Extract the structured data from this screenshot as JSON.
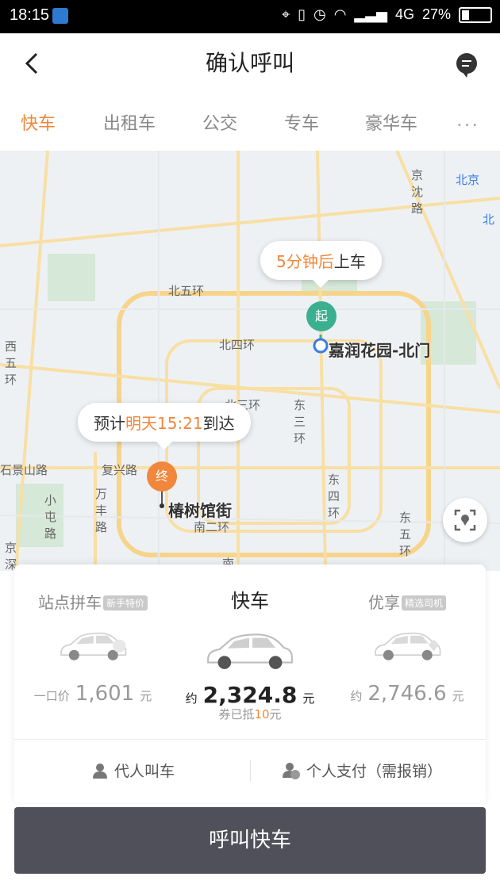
{
  "status": {
    "time": "18:15",
    "network": "4G",
    "battery": "27%",
    "battery_level": 0.27
  },
  "header": {
    "title": "确认呼叫"
  },
  "tabs": [
    {
      "label": "快车",
      "active": true
    },
    {
      "label": "出租车"
    },
    {
      "label": "公交"
    },
    {
      "label": "专车"
    },
    {
      "label": "豪华车"
    }
  ],
  "tabs_more": "···",
  "map": {
    "pickup_bubble": {
      "highlight": "5分钟后",
      "text": "上车"
    },
    "eta_bubble": {
      "prefix": "预计",
      "highlight": "明天15:21",
      "suffix": "到达"
    },
    "start_pin": "起",
    "start_place": "嘉润花园-北门",
    "end_pin": "终",
    "end_place": "椿树馆街",
    "labels": [
      "北五环",
      "北四环",
      "北三环",
      "东三环",
      "东四环",
      "东五环",
      "西五环",
      "复兴路",
      "石景山路",
      "万丰路",
      "小屯路",
      "南二环",
      "京沈路",
      "北京",
      "北",
      "南",
      "京深路"
    ]
  },
  "options": {
    "left": {
      "name": "站点拼车",
      "tag": "新手特价",
      "price_prefix": "一口价",
      "price": "1,601",
      "unit": "元"
    },
    "center": {
      "name": "快车",
      "price_prefix": "约",
      "price": "2,324.8",
      "unit": "元",
      "coupon_prefix": "券已抵",
      "coupon_amount": "10",
      "coupon_unit": "元"
    },
    "right": {
      "name": "优享",
      "tag": "精选司机",
      "price_prefix": "约",
      "price": "2,746.6",
      "unit": "元"
    }
  },
  "actions": {
    "proxy_call": "代人叫车",
    "payment": "个人支付（需报销）",
    "call_button": "呼叫快车"
  },
  "colors": {
    "accent": "#f0873c",
    "start_pin": "#3bb08f",
    "call_button_bg": "#4f5059"
  }
}
